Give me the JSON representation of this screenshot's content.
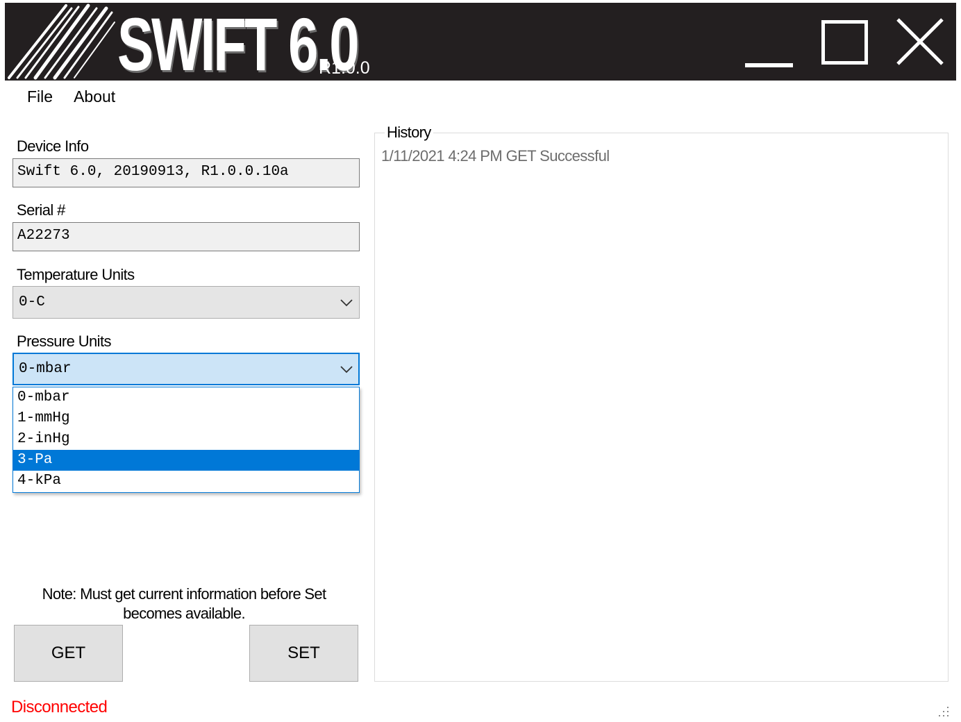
{
  "app": {
    "title": "SWIFT 6.0",
    "version": "R1.0.0"
  },
  "window_controls": {
    "minimize": "minimize-icon",
    "maximize": "maximize-icon",
    "close": "close-icon"
  },
  "menu": {
    "items": [
      {
        "label": "File"
      },
      {
        "label": "About"
      }
    ]
  },
  "device_info": {
    "label": "Device Info",
    "value": "Swift 6.0, 20190913, R1.0.0.10a"
  },
  "serial": {
    "label": "Serial #",
    "value": "A22273"
  },
  "temperature_units": {
    "label": "Temperature Units",
    "selected": "0-C"
  },
  "pressure_units": {
    "label": "Pressure Units",
    "selected": "0-mbar",
    "highlighted_option": "3-Pa",
    "options": [
      {
        "label": "0-mbar"
      },
      {
        "label": "1-mmHg"
      },
      {
        "label": "2-inHg"
      },
      {
        "label": "3-Pa"
      },
      {
        "label": "4-kPa"
      }
    ]
  },
  "note": "Note: Must get current information before Set becomes available.",
  "buttons": {
    "get": "GET",
    "set": "SET"
  },
  "history": {
    "title": "History",
    "entries": [
      {
        "text": "1/11/2021 4:24 PM GET Successful"
      }
    ]
  },
  "status": {
    "text": "Disconnected",
    "color": "#ff0000"
  },
  "colors": {
    "titlebar": "#231f20",
    "accent": "#0078d7",
    "combo_open_bg": "#cce4f7"
  }
}
